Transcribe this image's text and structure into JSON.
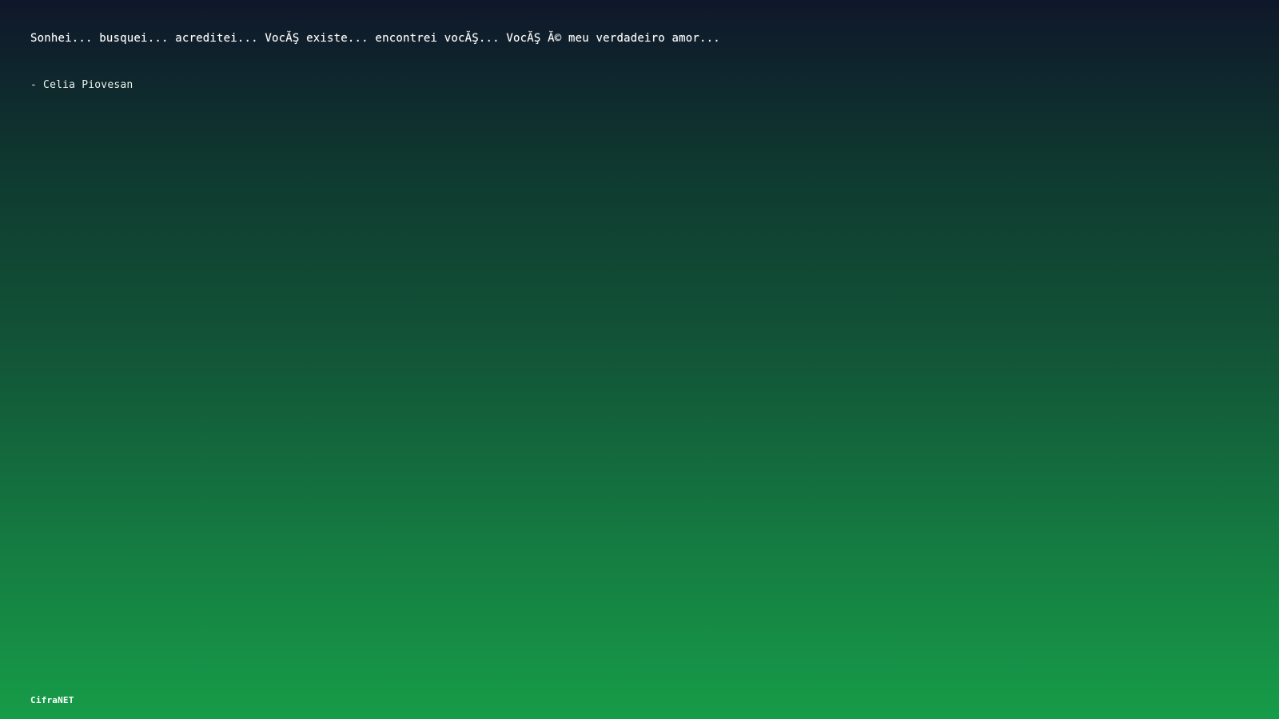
{
  "quote": {
    "text": "Sonhei... busquei... acreditei... VocĂŞ existe... encontrei vocĂŞ... VocĂŞ Ă© meu verdadeiro amor...",
    "author": "- Celia Piovesan"
  },
  "footer": {
    "brand": "CifraNET"
  },
  "colors": {
    "gradient_top": "#0f172a",
    "gradient_bottom": "#169c48",
    "text": "#ffffff"
  }
}
